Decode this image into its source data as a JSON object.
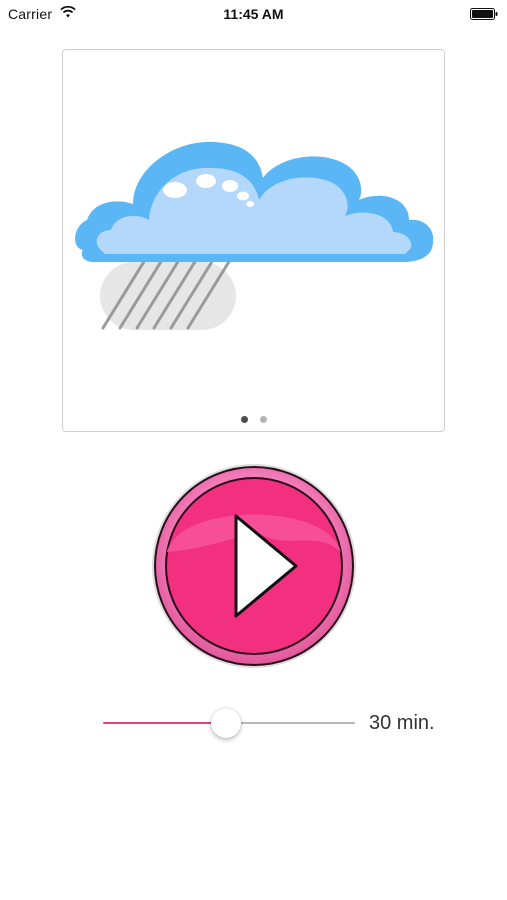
{
  "status_bar": {
    "carrier": "Carrier",
    "time": "11:45 AM",
    "wifi_icon": "wifi-icon",
    "battery_icon": "battery-icon"
  },
  "carousel": {
    "image": "rain-cloud-illustration",
    "page_count": 2,
    "current_page": 1
  },
  "player": {
    "play_icon": "play-icon",
    "accent_color": "#ee3385"
  },
  "timer": {
    "slider_value_fraction": 0.49,
    "duration_label": "30 min."
  },
  "colors": {
    "accent": "#e8407a",
    "cloud_light": "#b3d8fb",
    "cloud_dark": "#5bb6f5"
  }
}
